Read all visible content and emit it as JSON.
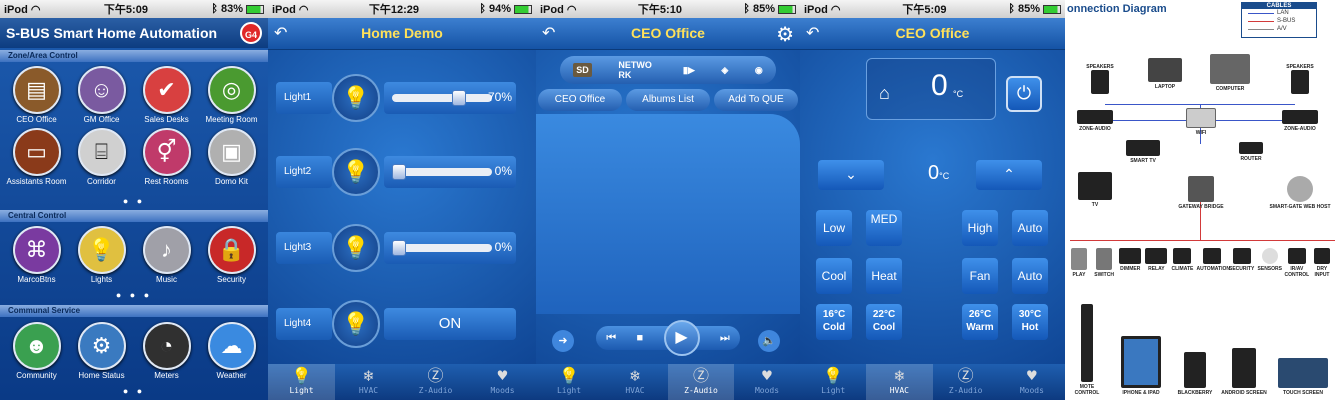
{
  "screens": [
    {
      "status": {
        "carrier": "iPod",
        "time": "下午5:09",
        "battery": "83%"
      },
      "title": "S-BUS Smart Home Automation",
      "badge": "G4",
      "sections": [
        {
          "header": "Zone/Area Control",
          "items": [
            "CEO Office",
            "GM Office",
            "Sales Desks",
            "Meeting Room",
            "Assistants Room",
            "Corridor",
            "Rest Rooms",
            "Domo Kit"
          ]
        },
        {
          "header": "Central Control",
          "items": [
            "MarcoBtns",
            "Lights",
            "Music",
            "Security"
          ]
        },
        {
          "header": "Communal Service",
          "items": [
            "Community",
            "Home Status",
            "Meters",
            "Weather"
          ]
        }
      ]
    },
    {
      "status": {
        "carrier": "iPod",
        "time": "下午12:29",
        "battery": "94%"
      },
      "title": "Home Demo",
      "lights": [
        {
          "name": "Light1",
          "level": 70,
          "value": "70%"
        },
        {
          "name": "Light2",
          "level": 0,
          "value": "0%"
        },
        {
          "name": "Light3",
          "level": 0,
          "value": "0%"
        },
        {
          "name": "Light4",
          "value": "ON"
        }
      ],
      "tabs": [
        "Light",
        "HVAC",
        "Z-Audio",
        "Moods"
      ]
    },
    {
      "status": {
        "carrier": "iPod",
        "time": "下午5:10",
        "battery": "85%"
      },
      "title": "CEO Office",
      "source_label": "NETWO RK",
      "source_icon_1": "SD",
      "media_tabs": [
        "CEO Office",
        "Albums List",
        "Add To QUE"
      ],
      "tabs": [
        "Light",
        "HVAC",
        "Z-Audio",
        "Moods"
      ]
    },
    {
      "status": {
        "carrier": "iPod",
        "time": "下午5:09",
        "battery": "85%"
      },
      "title": "CEO Office",
      "current_temp": "0",
      "temp_unit": "°C",
      "set_temp": "0",
      "set_unit": "°C",
      "fan_buttons": [
        "Low",
        "MED",
        "High",
        "Auto"
      ],
      "mode_buttons": [
        "Cool",
        "Heat",
        "Fan",
        "Auto"
      ],
      "preset_buttons": [
        {
          "temp": "16°C",
          "label": "Cold"
        },
        {
          "temp": "22°C",
          "label": "Cool"
        },
        {
          "temp": "26°C",
          "label": "Warm"
        },
        {
          "temp": "30°C",
          "label": "Hot"
        }
      ],
      "tabs": [
        "Light",
        "HVAC",
        "Z-Audio",
        "Moods"
      ]
    },
    {
      "title": "onnection Diagram",
      "legend": {
        "header": "CABLES",
        "items": [
          "LAN",
          "S-BUS",
          "A/V"
        ]
      },
      "devices_top": [
        "SPEAKERS",
        "LAPTOP",
        "COMPUTER",
        "SPEAKERS"
      ],
      "devices_mid": [
        "ZONE-AUDIO",
        "WIFI",
        "ZONE-AUDIO",
        "SMART TV",
        "ROUTER"
      ],
      "devices_low": [
        "TV",
        "GATEWAY BRIDGE",
        "SMART-GATE WEB HOST"
      ],
      "modules": [
        "PLAY",
        "SWITCH",
        "DIMMER",
        "RELAY",
        "CLIMATE",
        "AUTOMATION",
        "SECURITY",
        "SENSORS",
        "IR/AV CONTROL",
        "DRY INPUT"
      ],
      "controllers": [
        "MOTE CONTROL",
        "IPHONE & IPAD",
        "BLACKBERRY",
        "ANDROID SCREEN",
        "TOUCH SCREEN"
      ]
    }
  ],
  "colors": {
    "title_yellow": "#ffe15a",
    "lan": "#3a56c8",
    "sbus": "#d23a3a",
    "av": "#888888"
  }
}
